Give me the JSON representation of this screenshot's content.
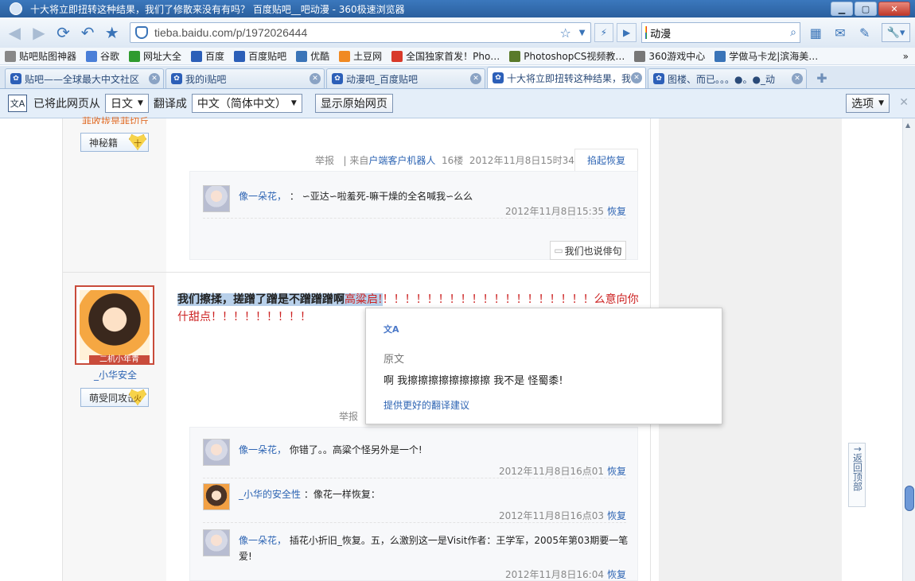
{
  "window": {
    "title": "十大将立即扭转这种结果，我们了修散来没有有吗？ 百度贴吧__吧动漫 - 360极速浏览器",
    "min": "▁",
    "max": "▢",
    "close": "✕"
  },
  "nav": {
    "url_value": "tieba.baidu.com/p/1972026444",
    "search_value": "动漫"
  },
  "bookmarks": {
    "items": [
      {
        "label": "贴吧贴图神器",
        "color": "#888888"
      },
      {
        "label": "谷歌",
        "color": "#4a7fd8"
      },
      {
        "label": "网址大全",
        "color": "#2f9b2f"
      },
      {
        "label": "百度",
        "color": "#2c5fb8"
      },
      {
        "label": "百度贴吧",
        "color": "#2c5fb8"
      },
      {
        "label": "优酷",
        "color": "#3a74b8"
      },
      {
        "label": "土豆网",
        "color": "#f08a24"
      },
      {
        "label": "全国独家首发！Pho…",
        "color": "#d83a2a"
      },
      {
        "label": "PhotoshopCS视频教…",
        "color": "#5a7a2a"
      },
      {
        "label": "360游戏中心",
        "color": "#777777"
      },
      {
        "label": "学做马卡龙|滨海美…",
        "color": "#3a74b8"
      }
    ],
    "more": "»"
  },
  "tabs": [
    {
      "label": "贴吧——全球最大中文社区"
    },
    {
      "label": "我的i贴吧"
    },
    {
      "label": "动漫吧_百度贴吧"
    },
    {
      "label": "十大将立即扭转这种结果，我"
    },
    {
      "label": "图楼、而已。。。●。●_动"
    }
  ],
  "translate": {
    "prefix": "已将此网页从",
    "source_lang": "日文",
    "middle": "翻译成",
    "target_lang": "中文（简体中文）",
    "show_original": "显示原始网页",
    "options": "选项",
    "close": "✕"
  },
  "post1": {
    "user_cut": "菲收拢是菲切丘",
    "badge": "神秘籍",
    "badge_icon": "十",
    "report": "举报",
    "source_prefix": "| 来自",
    "source_link": "户端客户机器人",
    "floor": "16楼",
    "time": "2012年11月8日15时34分",
    "collapse": "掐起恢复",
    "reply": {
      "user": "像一朵花，",
      "sep": "：",
      "text": "∽亚达∽啦羞死-嘛干燥的全名喊我∽么么",
      "time": "2012年11月8日15:35",
      "link": "恢复"
    },
    "say": "我们也说俳句"
  },
  "post2": {
    "avatar_tag": "二机小年青",
    "username": "_小华安全",
    "badge": "萌受同攻击",
    "badge_icon": "火",
    "text_bold": "我们擦揉，搓蹭了蹭是不蹭蹭蹭啊",
    "text_hl": "高粱启!",
    "text_red": "！！！！！！！！！！！！！！！！！！！么意向你什甜点！！！！！！！！！",
    "report": "举报",
    "replies": [
      {
        "user": "像一朵花，",
        "text": "你错了。。高粱个怪另外是一个!",
        "time": "2012年11月8日16点01",
        "link": "恢复"
      },
      {
        "user": "_小华的安全性",
        "text": "：像花一样恢复：",
        "time": "2012年11月8日16点03",
        "link": "恢复"
      },
      {
        "user": "像一朵花，",
        "text": "插花小折旧_恢复。五，么激别这一是Visit作者：王学军，2005年第03期要一笔爱!",
        "time": "2012年11月8日16:04",
        "link": "恢复"
      }
    ]
  },
  "tooltip": {
    "icon": "文A",
    "original_label": "原文",
    "original_text": "啊 我擦擦擦擦擦擦擦擦 我不是 怪蜀黍!",
    "better": "提供更好的翻译建议"
  },
  "scroll_top": "↑返回顶部"
}
